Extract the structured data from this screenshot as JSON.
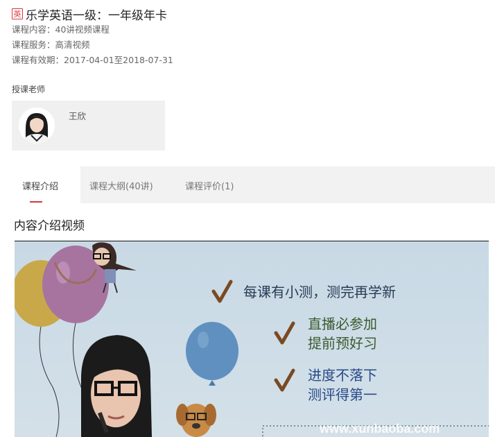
{
  "course": {
    "badge": "英",
    "title": "乐学英语一级：一年级年卡",
    "content_label": "课程内容：",
    "content_value": "40讲视频课程",
    "service_label": "课程服务：",
    "service_value": "高清视频",
    "validity_label": "课程有效期：",
    "validity_value": "2017-04-01至2018-07-31"
  },
  "teacher_section": {
    "label": "授课老师",
    "teacher_name": "王欣"
  },
  "tabs": [
    {
      "label": "课程介绍",
      "active": true
    },
    {
      "label": "课程大纲(40讲)",
      "active": false
    },
    {
      "label": "课程评价(1)",
      "active": false
    }
  ],
  "intro": {
    "title": "内容介绍视频"
  },
  "video_slide": {
    "line1": "每课有小测，测完再学新",
    "line2a": "直播必参加",
    "line2b": "提前预好习",
    "line3a": "进度不落下",
    "line3b": "测评得第一",
    "watermark": "www.xunbaoba.com"
  },
  "colors": {
    "accent": "#d9363e",
    "slide_text": "#2a3a55",
    "slide_text_green": "#3b5a2f",
    "checkmark": "#7a4a22"
  }
}
